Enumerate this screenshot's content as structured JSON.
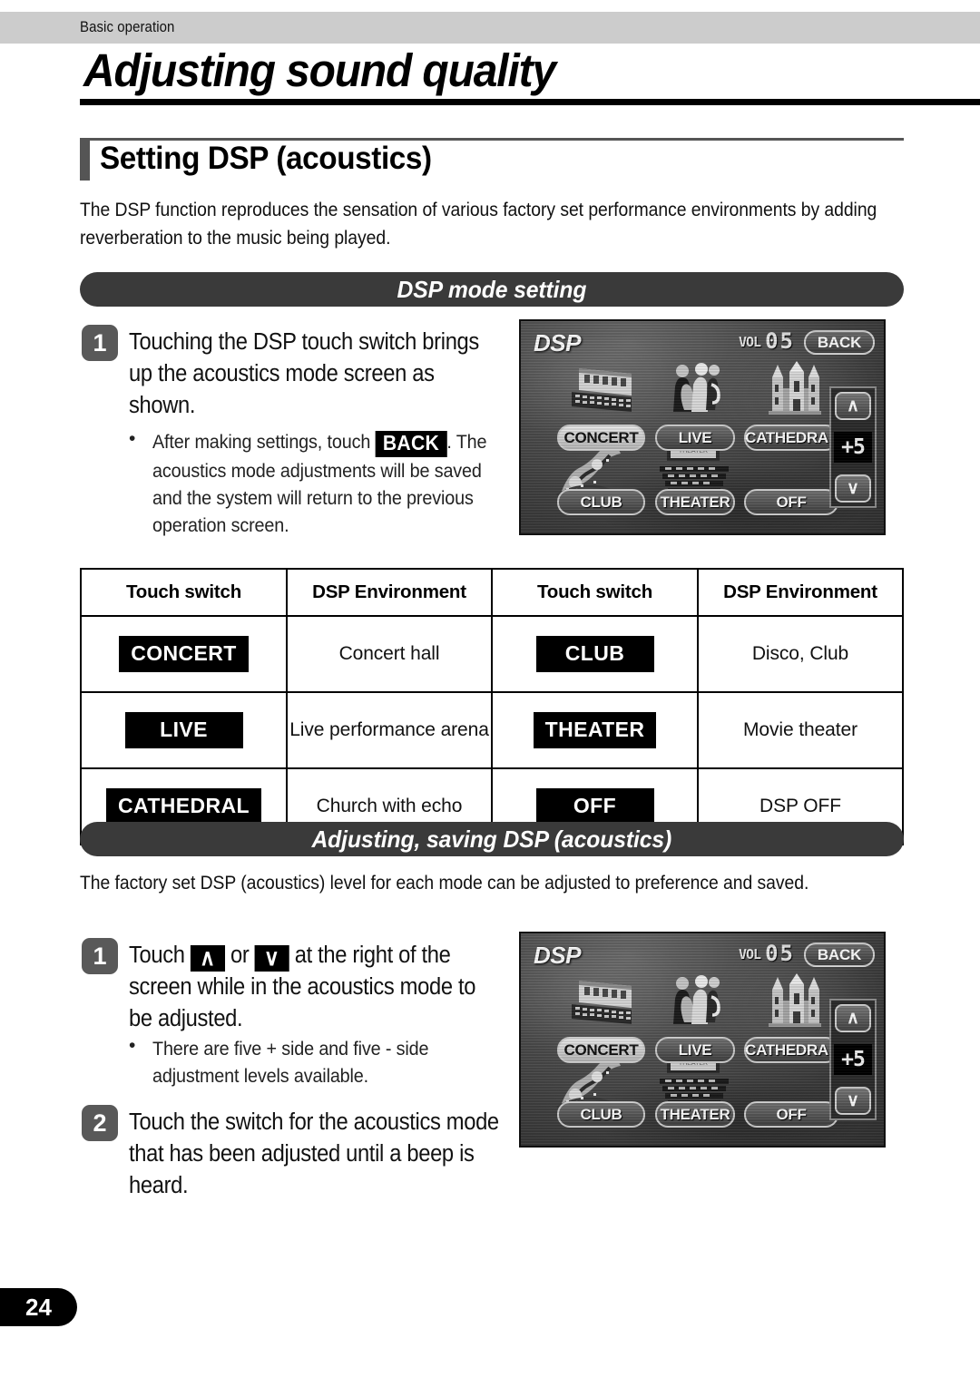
{
  "running_header": {
    "label": "Basic operation"
  },
  "chapter": {
    "title": "Adjusting sound quality"
  },
  "section": {
    "title": "Setting DSP (acoustics)",
    "intro": "The DSP function reproduces the sensation of various factory set performance environments by adding reverberation to the music being played."
  },
  "banners": {
    "dsp_mode_setting": "DSP mode setting",
    "adjusting_saving": "Adjusting, saving DSP (acoustics)"
  },
  "steps": {
    "mode_step1": {
      "number": "1",
      "text": "Touching the DSP touch switch brings up the acoustics mode screen as shown.",
      "bullet_prefix": "After making settings, touch",
      "bullet_key": "BACK",
      "bullet_suffix": ". The acoustics mode adjustments will be saved and the system will return to the previous operation screen."
    },
    "adjust_step1": {
      "number": "1",
      "text_a": "Touch",
      "key_up": "∧",
      "text_b": "or",
      "key_down": "∨",
      "text_c": "at the right of the screen while in the acoustics mode to be adjusted.",
      "bullet": "There are five + side and five - side adjustment levels available."
    },
    "adjust_step2": {
      "number": "2",
      "text": "Touch the switch for the acoustics mode that has been adjusted until a beep is heard."
    }
  },
  "adjust_intro": "The factory set DSP (acoustics) level for each mode can be adjusted to preference and saved.",
  "table": {
    "headers": [
      "Touch switch",
      "DSP Environment",
      "Touch switch",
      "DSP Environment"
    ],
    "rows": [
      {
        "sw_left": "CONCERT",
        "env_left": "Concert hall",
        "sw_right": "CLUB",
        "env_right": "Disco, Club"
      },
      {
        "sw_left": "LIVE",
        "env_left": "Live performance arena",
        "sw_right": "THEATER",
        "env_right": "Movie theater"
      },
      {
        "sw_left": "CATHEDRAL",
        "env_left": "Church with echo",
        "sw_right": "OFF",
        "env_right": "DSP OFF"
      }
    ]
  },
  "dsp_screen": {
    "title": "DSP",
    "vol_label": "VOL",
    "vol_value": "05",
    "back_label": "BACK",
    "level_up": "∧",
    "level_value": "+5",
    "level_down": "∨",
    "buttons": {
      "concert": "CONCERT",
      "live": "LIVE",
      "cathedral": "CATHEDRAL",
      "club": "CLUB",
      "theater": "THEATER",
      "off": "OFF"
    }
  },
  "footer": {
    "page_number": "24"
  }
}
